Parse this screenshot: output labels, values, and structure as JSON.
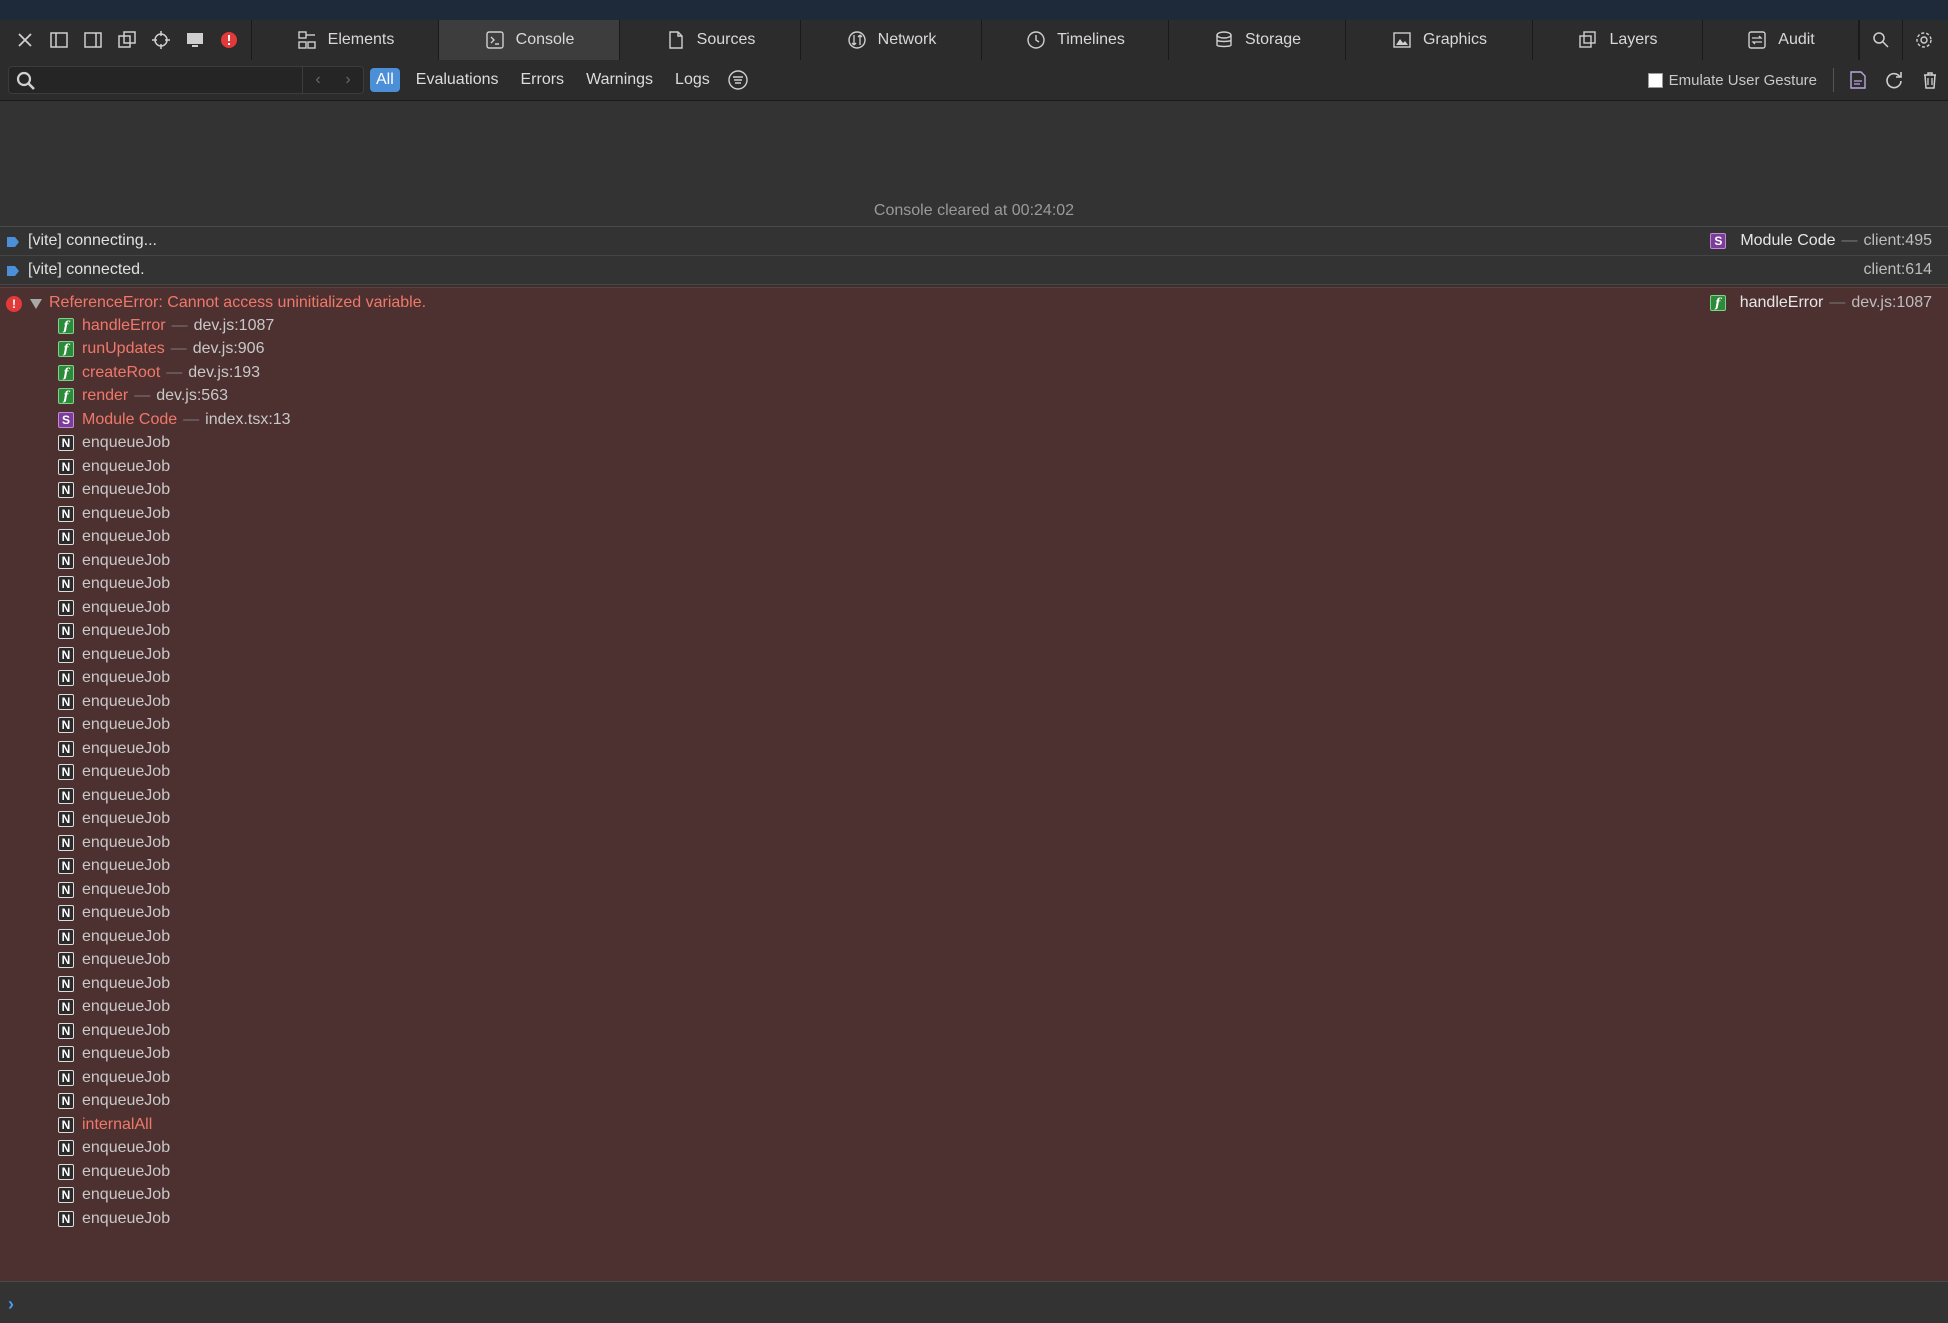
{
  "tabbar": {
    "left_icons": [
      "close-icon",
      "dock-left-icon",
      "dock-right-icon",
      "detach-window-icon",
      "inspect-element-icon",
      "device-settings-icon",
      "error-breakpoint-icon"
    ],
    "tabs": [
      {
        "label": "Elements",
        "icon": "elements-icon",
        "active": false
      },
      {
        "label": "Console",
        "icon": "console-icon",
        "active": true
      },
      {
        "label": "Sources",
        "icon": "sources-icon",
        "active": false
      },
      {
        "label": "Network",
        "icon": "network-icon",
        "active": false
      },
      {
        "label": "Timelines",
        "icon": "timelines-icon",
        "active": false
      },
      {
        "label": "Storage",
        "icon": "storage-icon",
        "active": false
      },
      {
        "label": "Graphics",
        "icon": "graphics-icon",
        "active": false
      },
      {
        "label": "Layers",
        "icon": "layers-icon",
        "active": false
      },
      {
        "label": "Audit",
        "icon": "audit-icon",
        "active": false
      }
    ],
    "right_icons": [
      "search-icon",
      "settings-icon"
    ]
  },
  "filterbar": {
    "search_placeholder": "",
    "filters": [
      {
        "label": "All",
        "active": true
      },
      {
        "label": "Evaluations",
        "active": false
      },
      {
        "label": "Errors",
        "active": false
      },
      {
        "label": "Warnings",
        "active": false
      },
      {
        "label": "Logs",
        "active": false
      }
    ],
    "emulate_label": "Emulate User Gesture",
    "emulate_checked": false
  },
  "console": {
    "cleared": "Console cleared at 00:24:02",
    "messages": [
      {
        "text": "[vite] connecting...",
        "icon": "S",
        "func": "Module Code",
        "location": "client:495"
      },
      {
        "text": "[vite] connected.",
        "icon": "",
        "func": "",
        "location": "client:614"
      }
    ],
    "error": {
      "text": "ReferenceError: Cannot access uninitialized variable.",
      "func": "handleError",
      "location": "dev.js:1087",
      "frames": [
        {
          "type": "f",
          "name": "handleError",
          "loc": "dev.js:1087",
          "hl": true
        },
        {
          "type": "f",
          "name": "runUpdates",
          "loc": "dev.js:906",
          "hl": true
        },
        {
          "type": "f",
          "name": "createRoot",
          "loc": "dev.js:193",
          "hl": true
        },
        {
          "type": "f",
          "name": "render",
          "loc": "dev.js:563",
          "hl": true
        },
        {
          "type": "s",
          "name": "Module Code",
          "loc": "index.tsx:13",
          "hl": true
        },
        {
          "type": "n",
          "name": "enqueueJob",
          "loc": "",
          "hl": false
        },
        {
          "type": "n",
          "name": "enqueueJob",
          "loc": "",
          "hl": false
        },
        {
          "type": "n",
          "name": "enqueueJob",
          "loc": "",
          "hl": false
        },
        {
          "type": "n",
          "name": "enqueueJob",
          "loc": "",
          "hl": false
        },
        {
          "type": "n",
          "name": "enqueueJob",
          "loc": "",
          "hl": false
        },
        {
          "type": "n",
          "name": "enqueueJob",
          "loc": "",
          "hl": false
        },
        {
          "type": "n",
          "name": "enqueueJob",
          "loc": "",
          "hl": false
        },
        {
          "type": "n",
          "name": "enqueueJob",
          "loc": "",
          "hl": false
        },
        {
          "type": "n",
          "name": "enqueueJob",
          "loc": "",
          "hl": false
        },
        {
          "type": "n",
          "name": "enqueueJob",
          "loc": "",
          "hl": false
        },
        {
          "type": "n",
          "name": "enqueueJob",
          "loc": "",
          "hl": false
        },
        {
          "type": "n",
          "name": "enqueueJob",
          "loc": "",
          "hl": false
        },
        {
          "type": "n",
          "name": "enqueueJob",
          "loc": "",
          "hl": false
        },
        {
          "type": "n",
          "name": "enqueueJob",
          "loc": "",
          "hl": false
        },
        {
          "type": "n",
          "name": "enqueueJob",
          "loc": "",
          "hl": false
        },
        {
          "type": "n",
          "name": "enqueueJob",
          "loc": "",
          "hl": false
        },
        {
          "type": "n",
          "name": "enqueueJob",
          "loc": "",
          "hl": false
        },
        {
          "type": "n",
          "name": "enqueueJob",
          "loc": "",
          "hl": false
        },
        {
          "type": "n",
          "name": "enqueueJob",
          "loc": "",
          "hl": false
        },
        {
          "type": "n",
          "name": "enqueueJob",
          "loc": "",
          "hl": false
        },
        {
          "type": "n",
          "name": "enqueueJob",
          "loc": "",
          "hl": false
        },
        {
          "type": "n",
          "name": "enqueueJob",
          "loc": "",
          "hl": false
        },
        {
          "type": "n",
          "name": "enqueueJob",
          "loc": "",
          "hl": false
        },
        {
          "type": "n",
          "name": "enqueueJob",
          "loc": "",
          "hl": false
        },
        {
          "type": "n",
          "name": "enqueueJob",
          "loc": "",
          "hl": false
        },
        {
          "type": "n",
          "name": "enqueueJob",
          "loc": "",
          "hl": false
        },
        {
          "type": "n",
          "name": "enqueueJob",
          "loc": "",
          "hl": false
        },
        {
          "type": "n",
          "name": "enqueueJob",
          "loc": "",
          "hl": false
        },
        {
          "type": "n",
          "name": "enqueueJob",
          "loc": "",
          "hl": false
        },
        {
          "type": "n",
          "name": "internalAll",
          "loc": "",
          "hl": true
        },
        {
          "type": "n",
          "name": "enqueueJob",
          "loc": "",
          "hl": false
        },
        {
          "type": "n",
          "name": "enqueueJob",
          "loc": "",
          "hl": false
        },
        {
          "type": "n",
          "name": "enqueueJob",
          "loc": "",
          "hl": false
        },
        {
          "type": "n",
          "name": "enqueueJob",
          "loc": "",
          "hl": false
        }
      ]
    }
  },
  "prompt": {
    "value": ""
  },
  "colors": {
    "accent": "#4a8fd8",
    "error_bg": "#4d3131",
    "error_text": "#f0786a",
    "func_icon": "#2d8a3a",
    "script_icon": "#7a3d9a"
  }
}
